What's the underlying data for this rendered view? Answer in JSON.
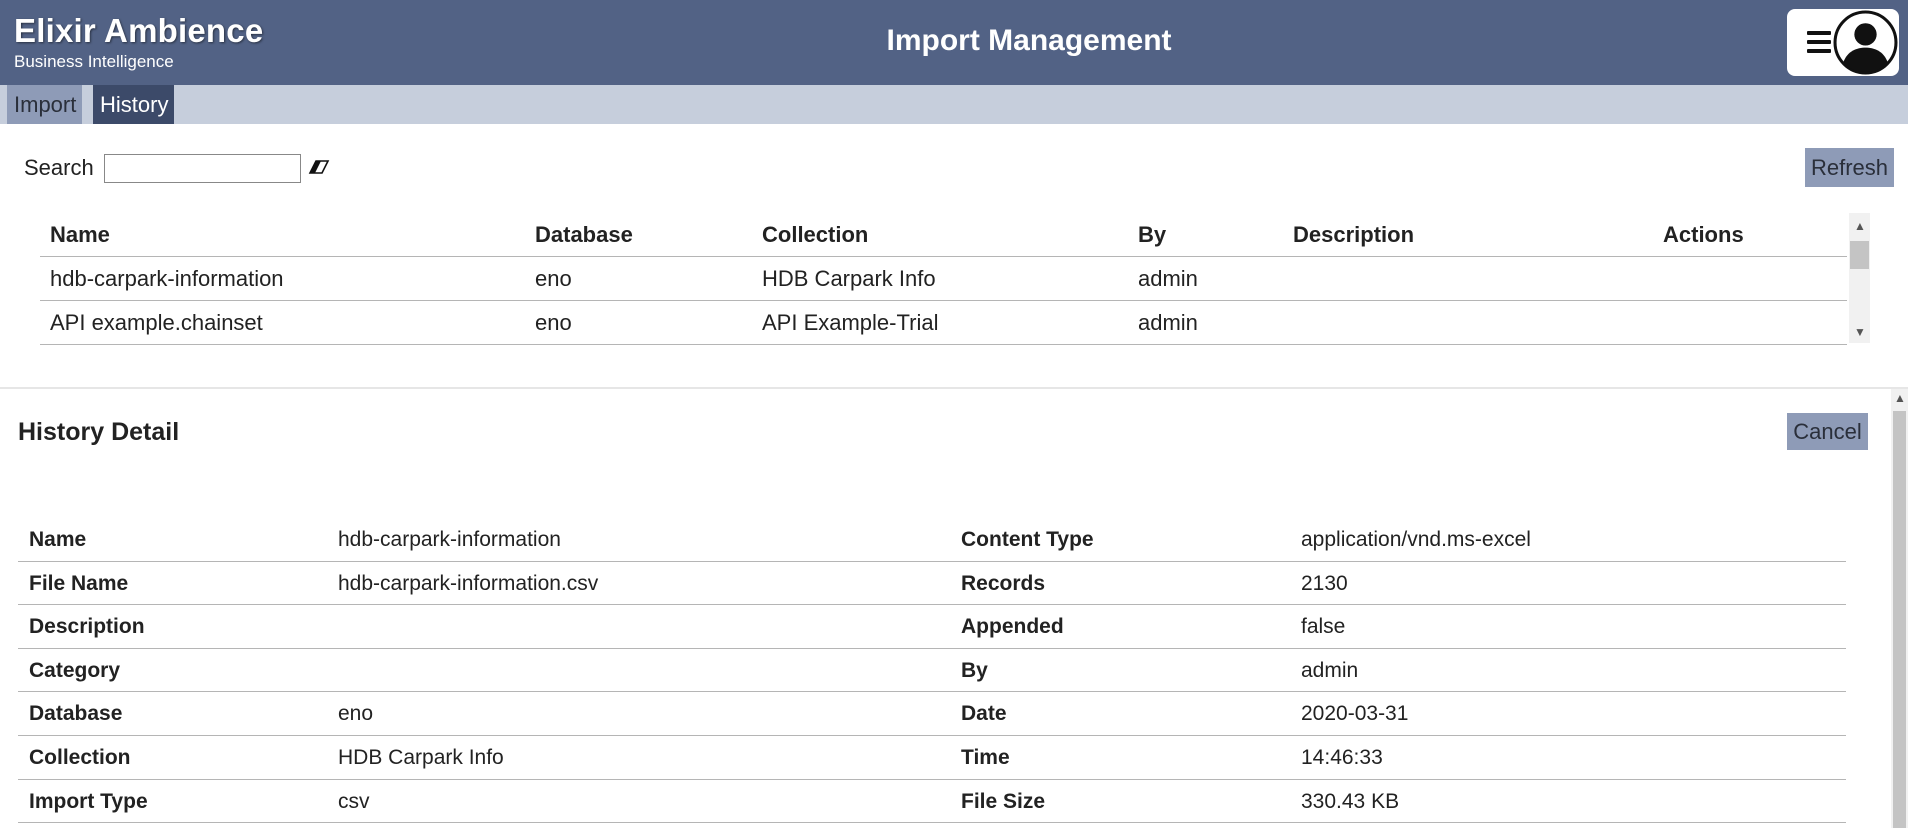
{
  "header": {
    "brand_name": "Elixir Ambience",
    "brand_sub": "Business Intelligence",
    "title": "Import Management"
  },
  "tabs": [
    {
      "label": "Import",
      "active": false
    },
    {
      "label": "History",
      "active": true
    }
  ],
  "search": {
    "label": "Search",
    "value": "",
    "refresh_label": "Refresh"
  },
  "list": {
    "columns": [
      "Name",
      "Database",
      "Collection",
      "By",
      "Description",
      "Actions"
    ],
    "rows": [
      [
        "hdb-carpark-information",
        "eno",
        "HDB Carpark Info",
        "admin",
        "",
        ""
      ],
      [
        "API example.chainset",
        "eno",
        "API Example-Trial",
        "admin",
        "",
        ""
      ]
    ]
  },
  "detail": {
    "title": "History Detail",
    "cancel_label": "Cancel",
    "rows": [
      [
        "Name",
        "hdb-carpark-information",
        "Content Type",
        "application/vnd.ms-excel"
      ],
      [
        "File Name",
        "hdb-carpark-information.csv",
        "Records",
        "2130"
      ],
      [
        "Description",
        "",
        "Appended",
        "false"
      ],
      [
        "Category",
        "",
        "By",
        "admin"
      ],
      [
        "Database",
        "eno",
        "Date",
        "2020-03-31"
      ],
      [
        "Collection",
        "HDB Carpark Info",
        "Time",
        "14:46:33"
      ],
      [
        "Import Type",
        "csv",
        "File Size",
        "330.43 KB"
      ]
    ]
  },
  "colors": {
    "header_bg": "#526285",
    "tabbar_bg": "#c6cedc",
    "tab_active": "#3c4a69",
    "tab_inactive": "#8e9bb7",
    "button_bg": "#8e9bb7"
  }
}
